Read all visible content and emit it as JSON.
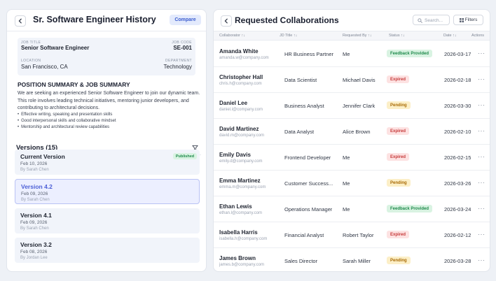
{
  "left": {
    "title": "Sr. Software Engineer History",
    "compare_label": "Compare",
    "job": {
      "title_label": "JOB TITLE",
      "title_value": "Senior Software Engineer",
      "code_label": "JOB CODE",
      "code_value": "SE-001",
      "location_label": "LOCATION",
      "location_value": "San Francisco, CA",
      "department_label": "DEPARTMENT",
      "department_value": "Technology"
    },
    "summary_heading": "POSITION SUMMARY & JOB SUMMARY",
    "summary_text": "We are seeking an experienced Senior Software Engineer to join our dynamic team. This role involves leading technical initiatives, mentoring junior developers, and contributing to architectural decisions.",
    "bullets": [
      "Effective writing, speaking and presentation skills",
      "Good interpersonal skills and collaborative mindset",
      "Mentorship and architectural review capabilities"
    ],
    "versions_heading": "Versions (15)",
    "versions": [
      {
        "name": "Current Version",
        "date": "Feb 10, 2026",
        "by": "By Sarah Chen",
        "badge": "Published"
      },
      {
        "name": "Version 4.2",
        "date": "Feb 09, 2026",
        "by": "By Sarah Chen"
      },
      {
        "name": "Version 4.1",
        "date": "Feb 09, 2026",
        "by": "By Sarah Chen"
      },
      {
        "name": "Version 3.2",
        "date": "Feb 08, 2026",
        "by": "By Jordan Lee"
      }
    ]
  },
  "right": {
    "title": "Requested Collaborations",
    "search_placeholder": "Search...",
    "filters_label": "Filters",
    "columns": {
      "collaborator": "Collaborator ↑↓",
      "jd_title": "JD Title ↑↓",
      "requested_by": "Requested By ↑↓",
      "status": "Status ↑↓",
      "date": "Date ↑↓",
      "actions": "Actions"
    },
    "rows": [
      {
        "name": "Amanda White",
        "email": "amanda.w@company.com",
        "jd": "HR Business Partner",
        "by": "Me",
        "status": "Feedback Provided",
        "status_type": "feedback",
        "date": "2026-03-17"
      },
      {
        "name": "Christopher Hall",
        "email": "chris.h@company.com",
        "jd": "Data Scientist",
        "by": "Michael Davis",
        "status": "Expired",
        "status_type": "expired",
        "date": "2026-02-18"
      },
      {
        "name": "Daniel Lee",
        "email": "daniel.l@company.com",
        "jd": "Business Analyst",
        "by": "Jennifer Clark",
        "status": "Pending",
        "status_type": "pending",
        "date": "2026-03-30"
      },
      {
        "name": "David Martinez",
        "email": "david.m@company.com",
        "jd": "Data Analyst",
        "by": "Alice Brown",
        "status": "Expired",
        "status_type": "expired",
        "date": "2026-02-10"
      },
      {
        "name": "Emily Davis",
        "email": "emily.d@company.com",
        "jd": "Frontend Developer",
        "by": "Me",
        "status": "Expired",
        "status_type": "expired",
        "date": "2026-02-15"
      },
      {
        "name": "Emma Martinez",
        "email": "emma.m@company.com",
        "jd": "Customer Success...",
        "by": "Me",
        "status": "Pending",
        "status_type": "pending",
        "date": "2026-03-26"
      },
      {
        "name": "Ethan Lewis",
        "email": "ethan.l@company.com",
        "jd": "Operations Manager",
        "by": "Me",
        "status": "Feedback Provided",
        "status_type": "feedback",
        "date": "2026-03-24"
      },
      {
        "name": "Isabella Harris",
        "email": "isabella.h@company.com",
        "jd": "Financial Analyst",
        "by": "Robert Taylor",
        "status": "Expired",
        "status_type": "expired",
        "date": "2026-02-12"
      },
      {
        "name": "James Brown",
        "email": "james.b@company.com",
        "jd": "Sales Director",
        "by": "Sarah Miller",
        "status": "Pending",
        "status_type": "pending",
        "date": "2026-03-28"
      }
    ],
    "action_glyph": "···"
  },
  "colors": {
    "accent": "#4c5fd6",
    "published": "#1f8a4c",
    "expired": "#c63a3a",
    "pending": "#a86a05"
  }
}
